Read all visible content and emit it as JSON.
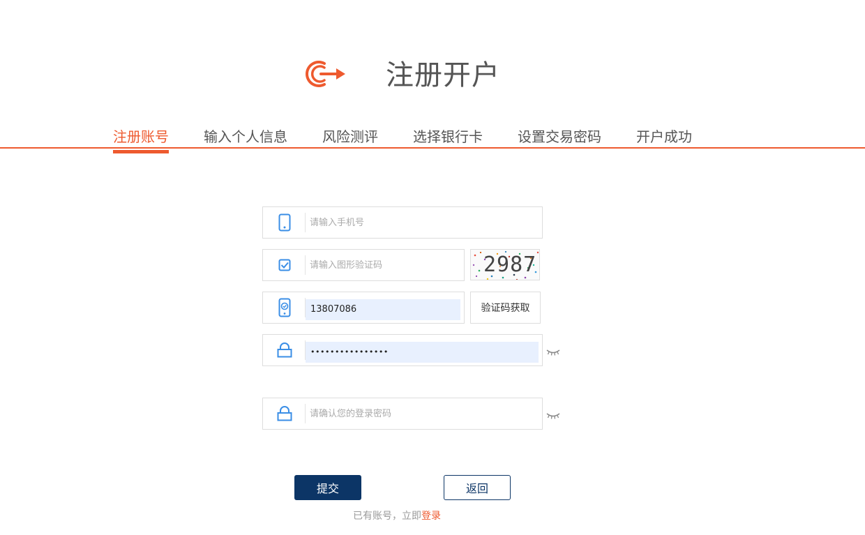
{
  "header": {
    "title": "注册开户",
    "logo_icon": "power-arrow-icon",
    "accent_color": "#ee5a2f"
  },
  "steps": [
    {
      "label": "注册账号",
      "active": true
    },
    {
      "label": "输入个人信息",
      "active": false
    },
    {
      "label": "风险测评",
      "active": false
    },
    {
      "label": "选择银行卡",
      "active": false
    },
    {
      "label": "设置交易密码",
      "active": false
    },
    {
      "label": "开户成功",
      "active": false
    }
  ],
  "form": {
    "phone": {
      "placeholder": "请输入手机号",
      "icon": "mobile-phone-icon"
    },
    "captcha": {
      "placeholder": "请输入图形验证码",
      "icon": "checkbox-icon",
      "image_text": "2987"
    },
    "sms_code": {
      "value": "13807086",
      "icon": "phone-verify-icon",
      "button_label": "验证码获取"
    },
    "password": {
      "value": "••••••••••••••••",
      "icon": "lock-icon",
      "eye_icon": "eye-closed-icon"
    },
    "confirm_password": {
      "placeholder": "请确认您的登录密码",
      "icon": "lock-icon",
      "eye_icon": "eye-closed-icon"
    }
  },
  "actions": {
    "submit_label": "提交",
    "back_label": "返回",
    "submit_color": "#0c3566"
  },
  "footer": {
    "hint_prefix": "已有账号，立即",
    "login_link": "登录"
  }
}
